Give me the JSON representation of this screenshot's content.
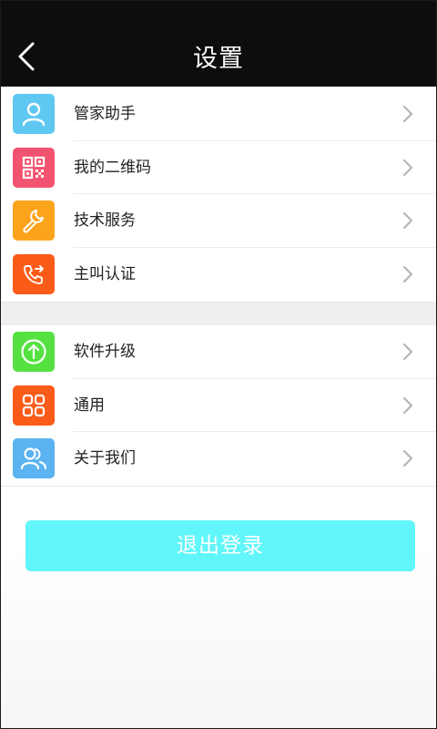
{
  "header": {
    "title": "设置",
    "back_icon": "chevron-left-icon"
  },
  "colors": {
    "header_bg": "#0d0d0d",
    "logout_bg": "#61f6fa",
    "chevron": "#b0b6bb"
  },
  "group1": [
    {
      "label": "管家助手",
      "icon": "user-icon",
      "color": "#5fc8f2"
    },
    {
      "label": "我的二维码",
      "icon": "qrcode-icon",
      "color": "#f2546f"
    },
    {
      "label": "技术服务",
      "icon": "wrench-icon",
      "color": "#fba31b"
    },
    {
      "label": "主叫认证",
      "icon": "phone-forward-icon",
      "color": "#fb5b18"
    }
  ],
  "group2": [
    {
      "label": "软件升级",
      "icon": "upgrade-arrow-icon",
      "color": "#55e241"
    },
    {
      "label": "通用",
      "icon": "grid-icon",
      "color": "#fb5b18"
    },
    {
      "label": "关于我们",
      "icon": "users-icon",
      "color": "#5bb3f1"
    }
  ],
  "logout": {
    "label": "退出登录"
  }
}
